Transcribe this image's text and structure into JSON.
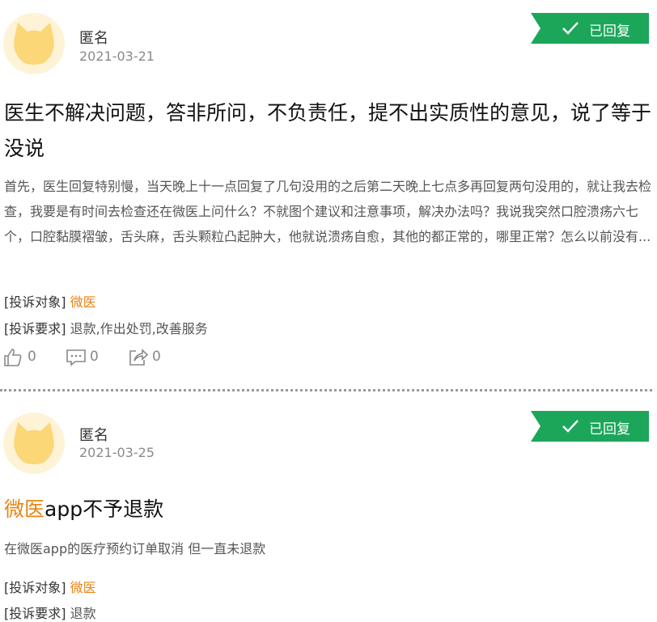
{
  "complaints": [
    {
      "user": "匿名",
      "date": "2021-03-21",
      "status": "已回复",
      "title_highlight": "",
      "title": "医生不解决问题，答非所问，不负责任，提不出实质性的意见，说了等于没说",
      "body": "首先，医生回复特别慢，当天晚上十一点回复了几句没用的之后第二天晚上七点多再回复两句没用的，就让我去检查，我要是有时间去检查还在微医上问什么？不就图个建议和注意事项，解决办法吗？我说我突然口腔溃疡六七个，口腔黏膜褶皱，舌头麻，舌头颗粒凸起肿大，他就说溃疡自愈，其他的都正常的，哪里正常？怎么以前没有...",
      "target_label": "[投诉对象]",
      "target": "微医",
      "demand_label": "[投诉要求]",
      "demand": "退款,作出处罚,改善服务",
      "likes": "0",
      "comments": "0",
      "shares": "0"
    },
    {
      "user": "匿名",
      "date": "2021-03-25",
      "status": "已回复",
      "title_highlight": "微医",
      "title": "app不予退款",
      "body": "在微医app的医疗预约订单取消 但一直未退款",
      "target_label": "[投诉对象]",
      "target": "微医",
      "demand_label": "[投诉要求]",
      "demand": "退款"
    }
  ],
  "icons": {
    "avatar": "cat-avatar-icon",
    "status": "check-icon",
    "like": "thumbs-up-icon",
    "comment": "comment-icon",
    "share": "share-icon"
  },
  "colors": {
    "status_badge": "#1ba65a",
    "highlight": "#e88413",
    "avatar_bg": "#fef3d7",
    "avatar_face": "#fcd778"
  }
}
